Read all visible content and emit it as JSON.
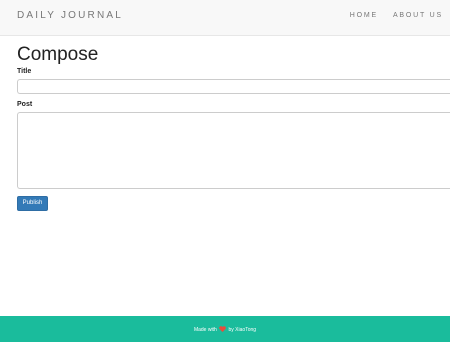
{
  "navbar": {
    "brand": "DAILY JOURNAL",
    "links": [
      {
        "label": "HOME"
      },
      {
        "label": "ABOUT US"
      }
    ]
  },
  "compose": {
    "heading": "Compose",
    "title_label": "Title",
    "title_value": "",
    "post_label": "Post",
    "post_value": "",
    "publish_label": "Publish"
  },
  "footer": {
    "prefix": "Made with",
    "icon": "heart-icon",
    "suffix": "by XiaoTong",
    "background": "#1abc9c"
  },
  "colors": {
    "button": "#337ab7",
    "navbar_bg": "#f8f8f8"
  }
}
